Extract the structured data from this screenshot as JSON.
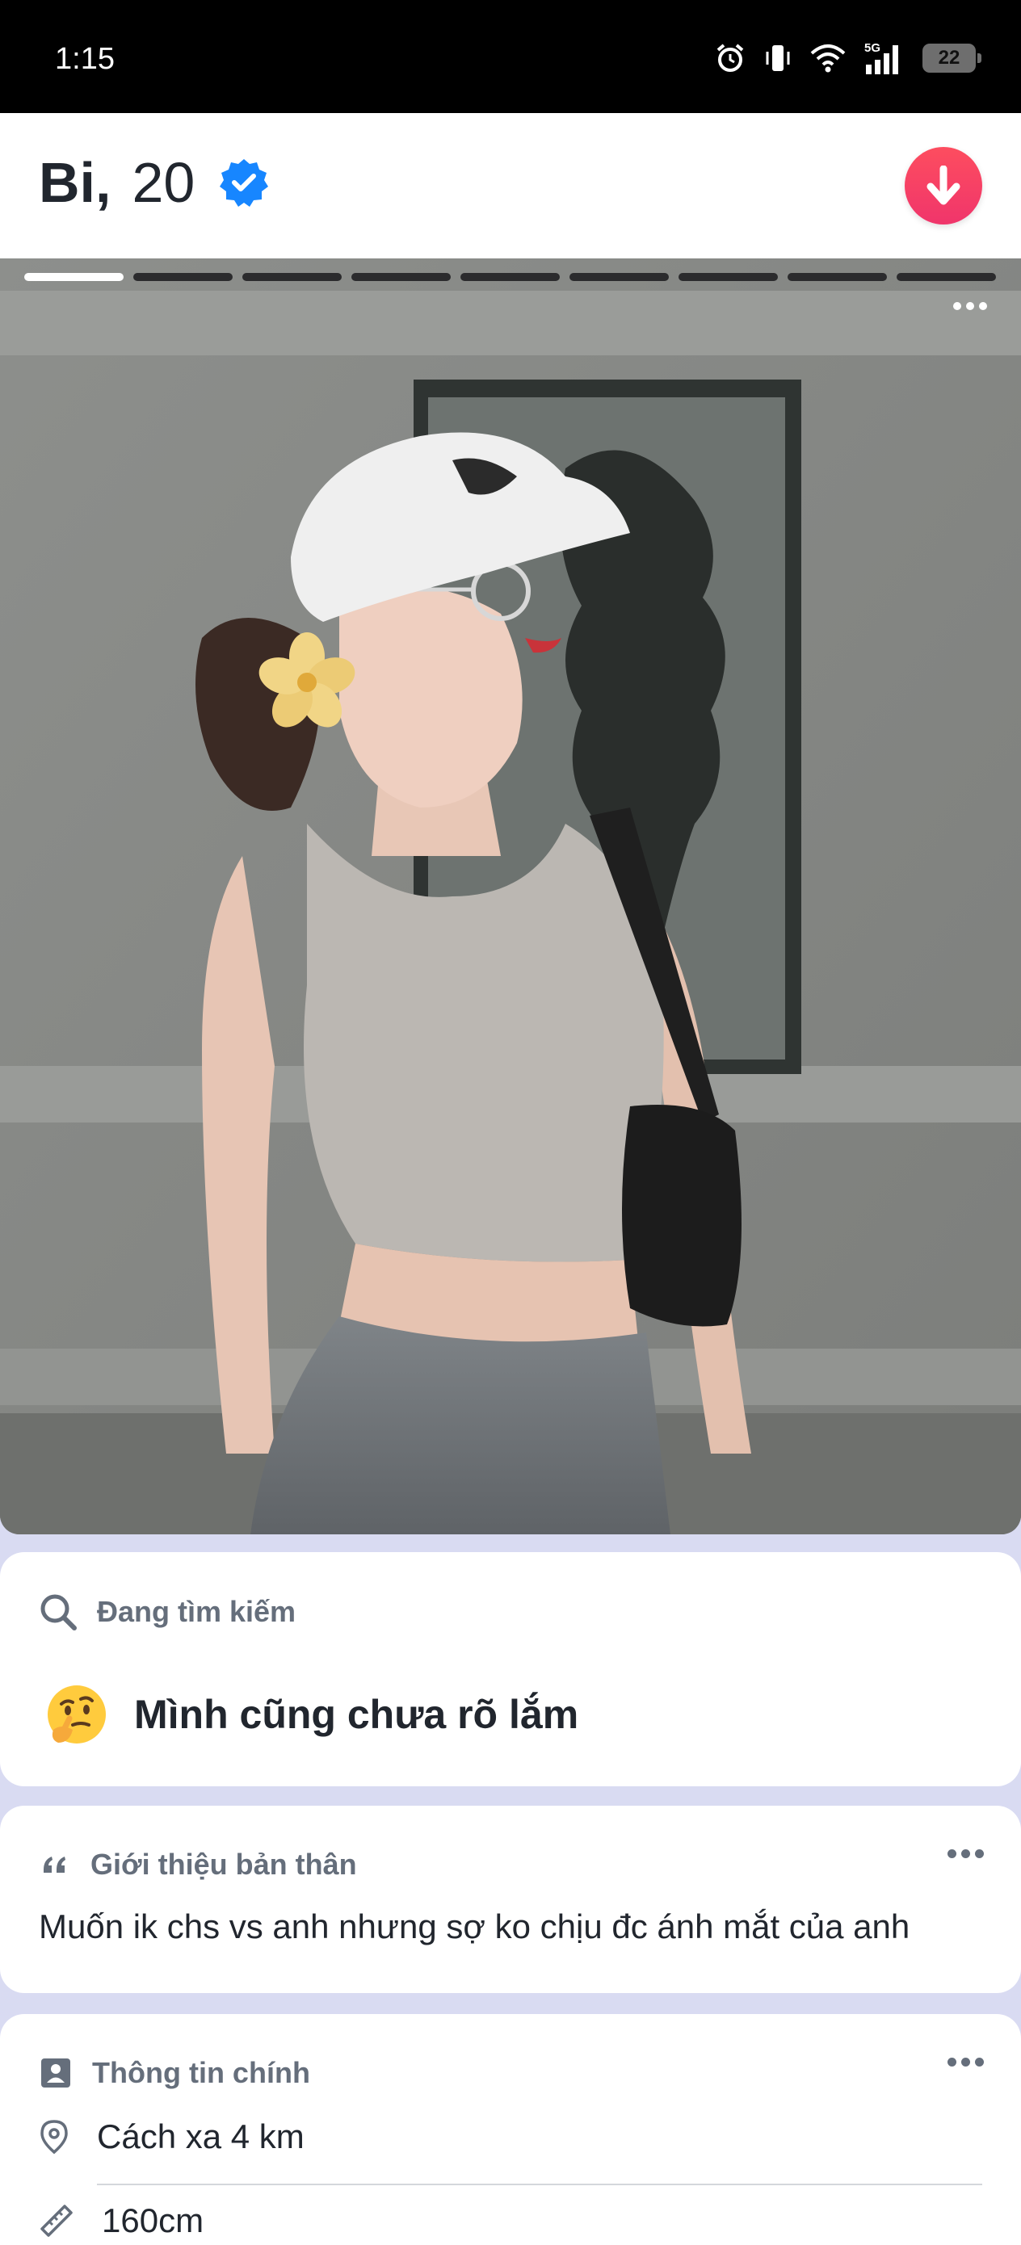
{
  "status_bar": {
    "time": "1:15",
    "network": "5G",
    "battery": "22"
  },
  "profile": {
    "name": "Bi,",
    "age": "20",
    "verified_icon": "verified-badge-icon",
    "collapse_icon": "arrow-down-icon",
    "accent_color": "#fd4d5f"
  },
  "photo": {
    "total_photos": 9,
    "current_photo": 1
  },
  "looking_for": {
    "label": "Đang tìm kiếm",
    "emoji": "thinking-face",
    "value": "Mình cũng chưa rõ lắm"
  },
  "about": {
    "label": "Giới thiệu bản thân",
    "text": "Muốn ik chs vs anh nhưng sợ ko chịu đc ánh mắt của anh"
  },
  "basics": {
    "label": "Thông tin chính",
    "distance": "Cách xa 4 km",
    "height": "160cm"
  }
}
